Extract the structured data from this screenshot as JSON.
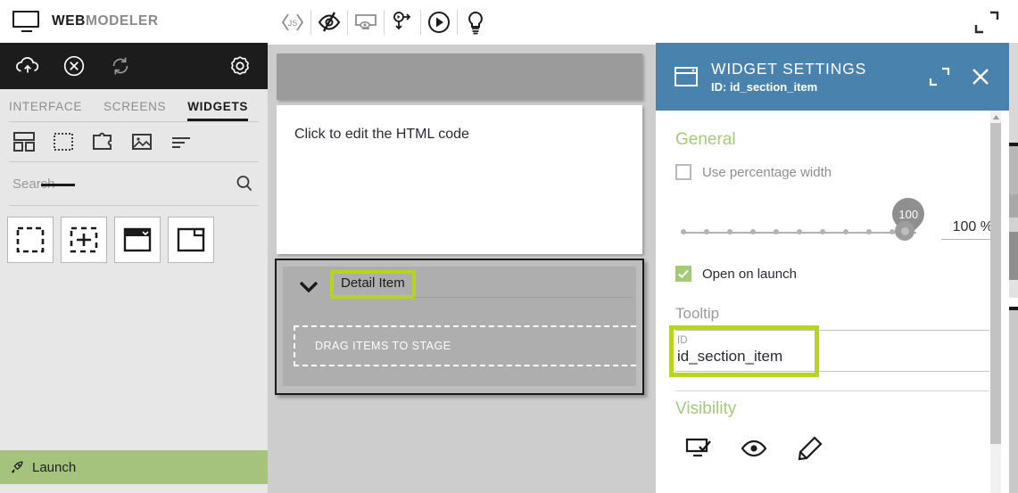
{
  "app": {
    "brand_part1": "WEB",
    "brand_part2": "MODELER",
    "accent_green": "#a5c97b",
    "highlight_green": "#b7d520",
    "panel_blue": "#4a82ae"
  },
  "sidebar": {
    "dark_toolbar": [
      {
        "name": "cloud-upload-icon",
        "label": "Cloud"
      },
      {
        "name": "close-circle-icon",
        "label": "Close"
      },
      {
        "name": "refresh-icon",
        "label": "Refresh"
      },
      {
        "name": "gear-icon",
        "label": "Settings"
      }
    ],
    "tabs": [
      {
        "label": "INTERFACE",
        "active": false
      },
      {
        "label": "SCREENS",
        "active": false
      },
      {
        "label": "WIDGETS",
        "active": true
      }
    ],
    "category_icons": [
      {
        "name": "layout-icon",
        "active": false
      },
      {
        "name": "dashed-box-icon",
        "active": true
      },
      {
        "name": "puzzle-icon",
        "active": false
      },
      {
        "name": "image-icon",
        "active": false
      },
      {
        "name": "list-icon",
        "active": false
      }
    ],
    "search": {
      "placeholder": "Search",
      "value": "",
      "icon": "search-icon"
    },
    "widget_thumbs": [
      {
        "name": "section-widget-thumb"
      },
      {
        "name": "grid-widget-thumb"
      },
      {
        "name": "window-widget-thumb"
      },
      {
        "name": "panel-widget-thumb"
      }
    ],
    "launch": {
      "label": "Launch",
      "icon": "rocket-icon"
    }
  },
  "center": {
    "toolbar": [
      {
        "name": "js-code-icon"
      },
      {
        "name": "hidden-eye-icon"
      },
      {
        "name": "preview-screen-icon"
      },
      {
        "name": "flow-icon"
      },
      {
        "name": "play-icon"
      },
      {
        "name": "lightbulb-icon"
      }
    ],
    "html_widget": {
      "text": "Click to edit the HTML code"
    },
    "detail_section": {
      "title": "Detail Item",
      "drop_text": "DRAG ITEMS TO STAGE",
      "chevron": "chevron-down-icon",
      "highlighted": true
    }
  },
  "right_panel": {
    "header": {
      "icon": "window-icon",
      "title": "WIDGET SETTINGS",
      "subtitle": "ID: id_section_item",
      "expand_icon": "expand-icon",
      "close_icon": "close-icon"
    },
    "general": {
      "heading": "General",
      "use_percentage_width": {
        "label": "Use percentage width",
        "checked": false
      },
      "slider": {
        "bubble_value": "100",
        "value_display": "100 %",
        "min": 0,
        "max": 100,
        "value": 100
      },
      "open_on_launch": {
        "label": "Open on launch",
        "checked": true
      }
    },
    "tooltip": {
      "heading": "Tooltip",
      "id_field": {
        "label": "ID",
        "value": "id_section_item",
        "highlighted": true
      }
    },
    "visibility": {
      "heading": "Visibility",
      "icons": [
        {
          "name": "screen-check-icon"
        },
        {
          "name": "eye-icon"
        },
        {
          "name": "pencil-icon"
        }
      ]
    }
  },
  "window": {
    "expand_icon": "expand-window-icon"
  }
}
